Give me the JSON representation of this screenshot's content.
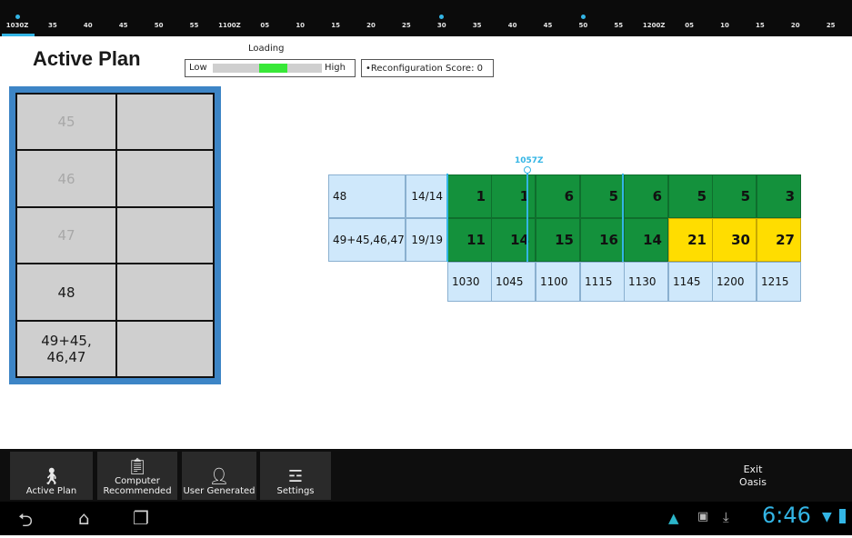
{
  "timeline": {
    "ticks": [
      {
        "label": "1030Z",
        "marked": true
      },
      {
        "label": "35",
        "marked": false
      },
      {
        "label": "40",
        "marked": false
      },
      {
        "label": "45",
        "marked": false
      },
      {
        "label": "50",
        "marked": false
      },
      {
        "label": "55",
        "marked": false
      },
      {
        "label": "1100Z",
        "marked": false
      },
      {
        "label": "05",
        "marked": false
      },
      {
        "label": "10",
        "marked": false
      },
      {
        "label": "15",
        "marked": false
      },
      {
        "label": "20",
        "marked": false
      },
      {
        "label": "25",
        "marked": false
      },
      {
        "label": "30",
        "marked": true
      },
      {
        "label": "35",
        "marked": false
      },
      {
        "label": "40",
        "marked": false
      },
      {
        "label": "45",
        "marked": false
      },
      {
        "label": "50",
        "marked": true
      },
      {
        "label": "55",
        "marked": false
      },
      {
        "label": "1200Z",
        "marked": false
      },
      {
        "label": "05",
        "marked": false
      },
      {
        "label": "10",
        "marked": false
      },
      {
        "label": "15",
        "marked": false
      },
      {
        "label": "20",
        "marked": false
      },
      {
        "label": "25",
        "marked": false
      }
    ],
    "accent_color": "#33b5e5"
  },
  "header": {
    "title": "Active Plan",
    "loading_label": "Loading",
    "loading_low": "Low",
    "loading_high": "High",
    "loading_level": 0.55,
    "reconfig_text": "•Reconfiguration Score: 0"
  },
  "sectors": [
    {
      "label": "45",
      "dim": true
    },
    {
      "label": "46",
      "dim": true
    },
    {
      "label": "47",
      "dim": true
    },
    {
      "label": "48",
      "dim": false
    },
    {
      "label": "49+45,\n46,47",
      "dim": false
    }
  ],
  "plan": {
    "now_label": "1057Z",
    "rows": [
      {
        "name": "48",
        "count": "14/14",
        "values": [
          "1",
          "1",
          "6",
          "5",
          "6",
          "5",
          "5",
          "3"
        ],
        "colors": [
          "green",
          "green",
          "green",
          "green",
          "green",
          "green",
          "green",
          "green"
        ]
      },
      {
        "name": "49+45,46,47",
        "count": "19/19",
        "values": [
          "11",
          "14",
          "15",
          "16",
          "14",
          "21",
          "30",
          "27"
        ],
        "colors": [
          "green",
          "green",
          "green",
          "green",
          "green",
          "yellow",
          "yellow",
          "yellow"
        ]
      }
    ],
    "times": [
      "1030",
      "1045",
      "1100",
      "1115",
      "1130",
      "1145",
      "1200",
      "1215"
    ]
  },
  "tabs": [
    {
      "label": "Active Plan",
      "icon": "walker-icon",
      "selected": true
    },
    {
      "label": "Computer\nRecommended",
      "icon": "clipboard-icon",
      "selected": false
    },
    {
      "label": "User Generated",
      "icon": "user-icon",
      "selected": false
    },
    {
      "label": "Settings",
      "icon": "sliders-icon",
      "selected": false
    }
  ],
  "exit_label": "Exit\nOasis",
  "system": {
    "clock": "6:46",
    "nav_icons": [
      "back-icon",
      "home-icon",
      "recents-icon"
    ]
  }
}
